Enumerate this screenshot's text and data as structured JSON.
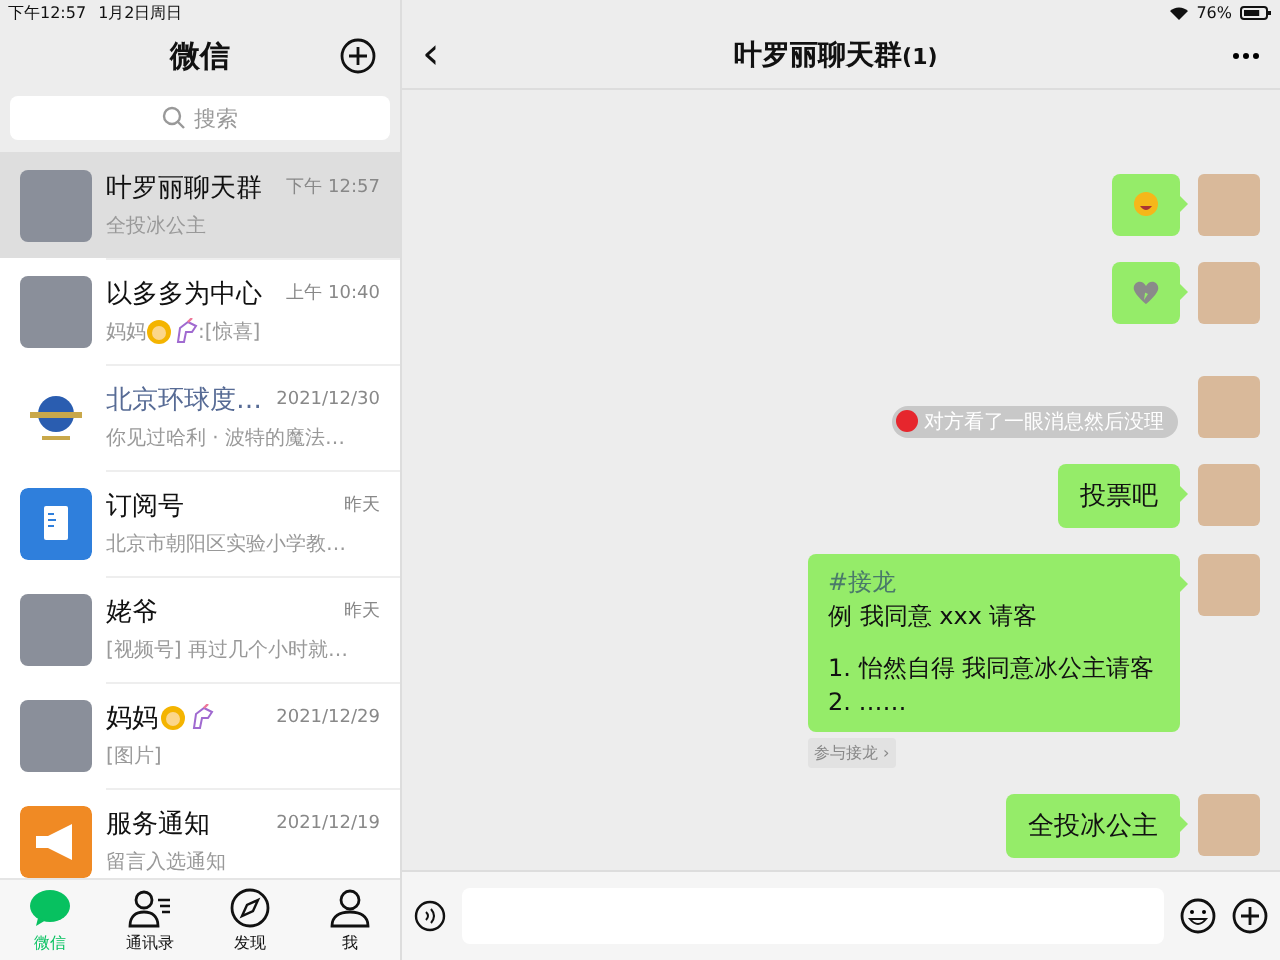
{
  "status_bar": {
    "time": "下午12:57",
    "date": "1月2日周日",
    "battery": "76%"
  },
  "sidebar": {
    "title": "微信",
    "search": {
      "placeholder": "搜索"
    },
    "chats": [
      {
        "name": "叶罗丽聊天群",
        "time": "下午 12:57",
        "preview": [
          {
            "kind": "text",
            "text": "全投冰公主"
          }
        ],
        "avatar": {
          "kind": "photo"
        },
        "kind": "chat",
        "selected": true
      },
      {
        "name": "以多多为中心",
        "time": "上午 10:40",
        "preview": [
          {
            "kind": "text",
            "text": "妈妈"
          },
          {
            "kind": "woman"
          },
          {
            "kind": "unicorn"
          },
          {
            "kind": "text",
            "text": ":[惊喜]"
          }
        ],
        "avatar": {
          "kind": "photo"
        },
        "kind": "chat",
        "selected": false
      },
      {
        "name": "北京环球度…",
        "time": "2021/12/30",
        "preview": [
          {
            "kind": "text",
            "text": "你见过哈利 · 波特的魔法…"
          }
        ],
        "avatar": {
          "kind": "logo"
        },
        "kind": "service",
        "selected": false
      },
      {
        "name": "订阅号",
        "time": "昨天",
        "preview": [
          {
            "kind": "text",
            "text": "北京市朝阳区实验小学教…"
          }
        ],
        "avatar": {
          "kind": "subscription"
        },
        "kind": "chat",
        "selected": false
      },
      {
        "name": "姥爷",
        "time": "昨天",
        "preview": [
          {
            "kind": "text",
            "text": "[视频号] 再过几个小时就…"
          }
        ],
        "avatar": {
          "kind": "photo"
        },
        "kind": "chat",
        "selected": false
      },
      {
        "name": "妈妈",
        "name_emoji": [
          {
            "kind": "woman"
          },
          {
            "kind": "unicorn"
          }
        ],
        "time": "2021/12/29",
        "preview": [
          {
            "kind": "text",
            "text": "[图片]"
          }
        ],
        "avatar": {
          "kind": "photo"
        },
        "kind": "chat",
        "selected": false
      },
      {
        "name": "服务通知",
        "time": "2021/12/19",
        "preview": [
          {
            "kind": "text",
            "text": "留言入选通知"
          }
        ],
        "avatar": {
          "kind": "notice"
        },
        "kind": "chat",
        "selected": false
      }
    ],
    "tabs": [
      {
        "label": "微信",
        "selected": true
      },
      {
        "label": "通讯录",
        "selected": false
      },
      {
        "label": "发现",
        "selected": false
      },
      {
        "label": "我",
        "selected": false
      }
    ]
  },
  "chat": {
    "back": "‹",
    "title": "叶罗丽聊天群",
    "count": "(1)",
    "messages": [
      {
        "kind": "sticker"
      },
      {
        "kind": "heart"
      },
      {
        "kind": "notice",
        "text": "对方看了一眼消息然后没理"
      },
      {
        "kind": "text",
        "text": "投票吧"
      },
      {
        "kind": "jielong",
        "tag": "#接龙",
        "paragraphs": [
          [
            "例 我同意 xxx 请客"
          ],
          [
            "1. 怡然自得 我同意冰公主请客",
            "2. ……"
          ]
        ],
        "action": "参与接龙 ›"
      },
      {
        "kind": "text",
        "text": "全投冰公主"
      }
    ]
  }
}
